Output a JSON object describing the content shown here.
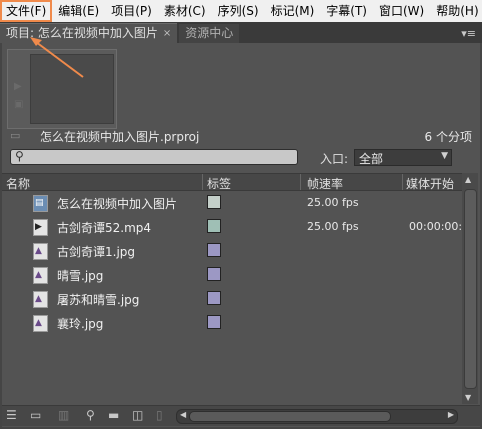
{
  "menu": [
    {
      "label": "文件(F)",
      "active": true
    },
    {
      "label": "编辑(E)"
    },
    {
      "label": "项目(P)"
    },
    {
      "label": "素材(C)"
    },
    {
      "label": "序列(S)"
    },
    {
      "label": "标记(M)"
    },
    {
      "label": "字幕(T)"
    },
    {
      "label": "窗口(W)"
    },
    {
      "label": "帮助(H)"
    }
  ],
  "tabs": {
    "project": "项目: 怎么在视频中加入图片",
    "media": "资源中心",
    "close_glyph": "×",
    "panel_menu_glyph": "▾≡"
  },
  "project": {
    "file_name": "怎么在视频中加入图片.prproj",
    "item_count": "6 个分项"
  },
  "search": {
    "value": "",
    "entry_label": "入口:",
    "entry_value": "全部"
  },
  "columns": {
    "name": "名称",
    "label": "标签",
    "frame_rate": "帧速率",
    "media_start": "媒体开始"
  },
  "items": [
    {
      "name": "怎么在视频中加入图片",
      "type": "sequence",
      "label_color": "#c4cfc9",
      "frame_rate": "25.00 fps",
      "media_start": ""
    },
    {
      "name": "古剑奇谭52.mp4",
      "type": "video",
      "label_color": "#9fbfb5",
      "frame_rate": "25.00 fps",
      "media_start": "00:00:00:"
    },
    {
      "name": "古剑奇谭1.jpg",
      "type": "image",
      "label_color": "#9c98c4",
      "frame_rate": "",
      "media_start": ""
    },
    {
      "name": "晴雪.jpg",
      "type": "image",
      "label_color": "#9c98c4",
      "frame_rate": "",
      "media_start": ""
    },
    {
      "name": "屠苏和晴雪.jpg",
      "type": "image",
      "label_color": "#9c98c4",
      "frame_rate": "",
      "media_start": ""
    },
    {
      "name": "襄玲.jpg",
      "type": "image",
      "label_color": "#9c98c4",
      "frame_rate": "",
      "media_start": ""
    }
  ],
  "colors": {
    "annotation": "#f08a4b",
    "panel_bg": "#535353"
  }
}
